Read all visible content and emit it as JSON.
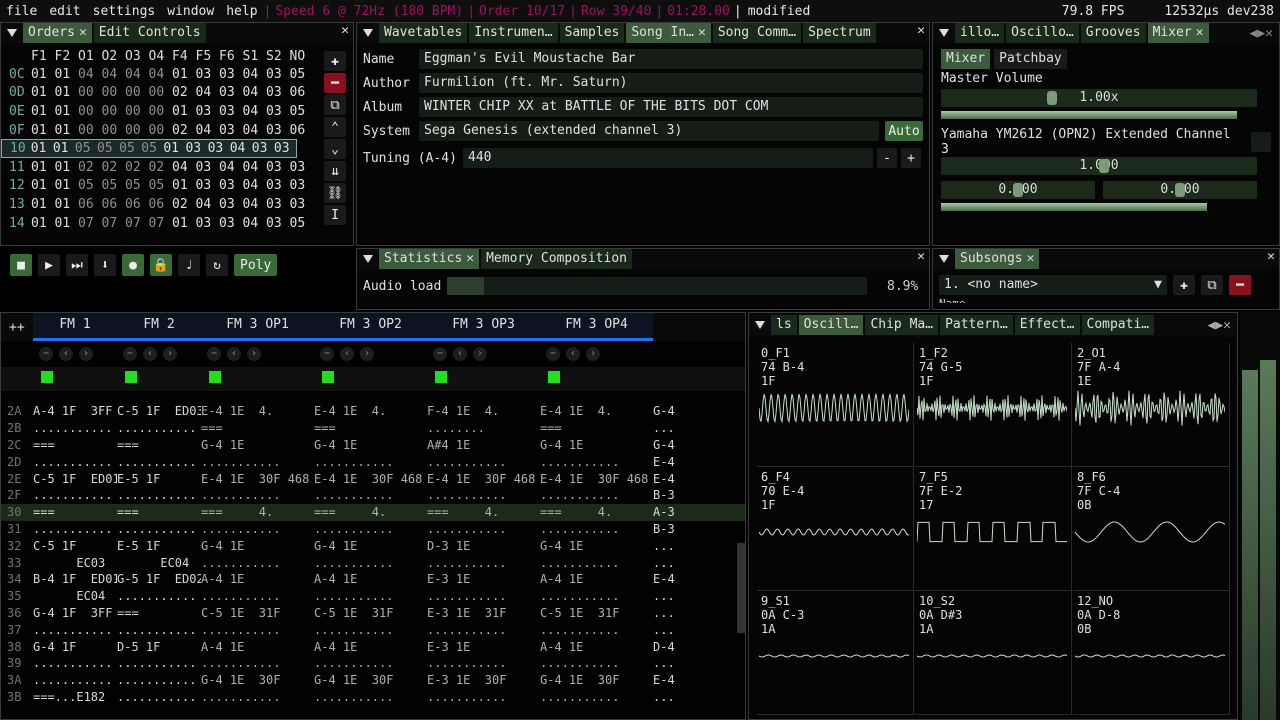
{
  "menu": {
    "items": [
      "file",
      "edit",
      "settings",
      "window",
      "help"
    ],
    "status": [
      "Speed 6 @ 72Hz (180 BPM)",
      "Order 10/17",
      "Row 39/40",
      "01:28.00"
    ],
    "modified": "modified",
    "fps": "79.8 FPS",
    "timing": "12532µs dev238"
  },
  "orders": {
    "tabs": [
      "Orders",
      "Edit Controls"
    ],
    "header": [
      "F1",
      "F2",
      "O1",
      "O2",
      "O3",
      "O4",
      "F4",
      "F5",
      "F6",
      "S1",
      "S2",
      "NO"
    ],
    "rows": [
      {
        "n": "0C",
        "v": [
          "01",
          "01",
          "04",
          "04",
          "04",
          "04",
          "01",
          "03",
          "03",
          "04",
          "03",
          "05"
        ]
      },
      {
        "n": "0D",
        "v": [
          "01",
          "01",
          "00",
          "00",
          "00",
          "00",
          "02",
          "04",
          "03",
          "04",
          "03",
          "06"
        ]
      },
      {
        "n": "0E",
        "v": [
          "01",
          "01",
          "00",
          "00",
          "00",
          "00",
          "01",
          "03",
          "03",
          "04",
          "03",
          "05"
        ]
      },
      {
        "n": "0F",
        "v": [
          "01",
          "01",
          "00",
          "00",
          "00",
          "00",
          "02",
          "04",
          "03",
          "04",
          "03",
          "06"
        ]
      },
      {
        "n": "10",
        "v": [
          "01",
          "01",
          "05",
          "05",
          "05",
          "05",
          "01",
          "03",
          "03",
          "04",
          "03",
          "03"
        ],
        "sel": true
      },
      {
        "n": "11",
        "v": [
          "01",
          "01",
          "02",
          "02",
          "02",
          "02",
          "04",
          "03",
          "04",
          "04",
          "03",
          "03"
        ]
      },
      {
        "n": "12",
        "v": [
          "01",
          "01",
          "05",
          "05",
          "05",
          "05",
          "01",
          "03",
          "03",
          "04",
          "03",
          "03"
        ]
      },
      {
        "n": "13",
        "v": [
          "01",
          "01",
          "06",
          "06",
          "06",
          "06",
          "02",
          "04",
          "03",
          "04",
          "03",
          "03"
        ]
      },
      {
        "n": "14",
        "v": [
          "01",
          "01",
          "07",
          "07",
          "07",
          "07",
          "01",
          "03",
          "03",
          "04",
          "03",
          "05"
        ]
      }
    ]
  },
  "songinfo": {
    "tabs": [
      "Wavetables",
      "Instrumen…",
      "Samples",
      "Song In…",
      "Song Comm…",
      "Spectrum"
    ],
    "name_label": "Name",
    "name": "Eggman's Evil Moustache Bar",
    "author_label": "Author",
    "author": "Furmilion (ft. Mr. Saturn)",
    "album_label": "Album",
    "album": "WINTER CHIP XX at BATTLE OF THE BITS DOT COM",
    "system_label": "System",
    "system": "Sega Genesis (extended channel 3)",
    "auto": "Auto",
    "tuning_label": "Tuning (A-4)",
    "tuning": "440",
    "minus": "-",
    "plus": "+"
  },
  "mixer": {
    "tabs": [
      "illo…",
      "Oscillo…",
      "Grooves",
      "Mixer"
    ],
    "subtabs": [
      "Mixer",
      "Patchbay"
    ],
    "master_label": "Master Volume",
    "master": "1.00x",
    "chip": "Yamaha YM2612 (OPN2) Extended Channel 3",
    "chip_vol": "1.000",
    "pan_l": "0.000",
    "pan_r": "0.000",
    "master_level": 0.66
  },
  "stats": {
    "tabs": [
      "Statistics",
      "Memory Composition"
    ],
    "audio_label": "Audio load",
    "audio": "8.9%",
    "load": 0.089
  },
  "subsongs": {
    "tab": "Subsongs",
    "item": "1. <no name>",
    "name_label": "Name"
  },
  "transport": {
    "poly": "Poly"
  },
  "pattern": {
    "channels": [
      "FM 1",
      "FM 2",
      "FM 3 OP1",
      "FM 3 OP2",
      "FM 3 OP3",
      "FM 3 OP4"
    ],
    "plus": "++",
    "rows": [
      {
        "n": "2A",
        "c": [
          "A-4 1F  3FF",
          "C-5 1F  ED03",
          "E-4 1E  4.",
          "E-4 1E  4.",
          "F-4 1E  4.",
          "E-4 1E  4.",
          "G-4"
        ]
      },
      {
        "n": "2B",
        "c": [
          "...........",
          "...........",
          "===        ",
          "===        ",
          "........",
          "===        ",
          "..."
        ]
      },
      {
        "n": "2C",
        "c": [
          "===        ",
          "===        ",
          "G-4 1E     ",
          "G-4 1E     ",
          "A#4 1E     ",
          "G-4 1E     ",
          "G-4"
        ]
      },
      {
        "n": "2D",
        "c": [
          "...........",
          "...........",
          "...........",
          "...........",
          "...........",
          "...........",
          "E-4"
        ]
      },
      {
        "n": "2E",
        "c": [
          "C-5 1F  ED01",
          "E-5 1F     ",
          "E-4 1E  30F 468",
          "E-4 1E  30F 468",
          "E-4 1E  30F 468",
          "E-4 1E  30F 468",
          "E-4"
        ]
      },
      {
        "n": "2F",
        "c": [
          "...........",
          "...........",
          "...........",
          "...........",
          "...........",
          "...........",
          "B-3"
        ]
      },
      {
        "n": "30",
        "c": [
          "===        ",
          "===        ",
          "===     4.",
          "===     4.",
          "===     4.",
          "===     4.",
          "A-3"
        ],
        "cur": true
      },
      {
        "n": "31",
        "c": [
          "...........",
          "...........",
          "...........",
          "...........",
          "...........",
          "...........",
          "B-3"
        ]
      },
      {
        "n": "32",
        "c": [
          "C-5 1F     ",
          "E-5 1F     ",
          "G-4 1E     ",
          "G-4 1E     ",
          "D-3 1E     ",
          "G-4 1E     ",
          "..."
        ]
      },
      {
        "n": "33",
        "c": [
          "      EC03 ",
          "      EC04 ",
          "...........",
          "...........",
          "...........",
          "...........",
          "..."
        ]
      },
      {
        "n": "34",
        "c": [
          "B-4 1F  ED01",
          "G-5 1F  ED02",
          "A-4 1E     ",
          "A-4 1E     ",
          "E-3 1E     ",
          "A-4 1E     ",
          "E-4"
        ]
      },
      {
        "n": "35",
        "c": [
          "      EC04 ",
          "...........",
          "...........",
          "...........",
          "...........",
          "...........",
          "..."
        ]
      },
      {
        "n": "36",
        "c": [
          "G-4 1F  3FF",
          "===        ",
          "C-5 1E  31F",
          "C-5 1E  31F",
          "E-3 1E  31F",
          "C-5 1E  31F",
          "..."
        ]
      },
      {
        "n": "37",
        "c": [
          "...........",
          "...........",
          "...........",
          "...........",
          "...........",
          "...........",
          "..."
        ]
      },
      {
        "n": "38",
        "c": [
          "G-4 1F     ",
          "D-5 1F     ",
          "A-4 1E     ",
          "A-4 1E     ",
          "E-3 1E     ",
          "A-4 1E     ",
          "D-4"
        ]
      },
      {
        "n": "39",
        "c": [
          "...........",
          "...........",
          "...........",
          "...........",
          "...........",
          "...........",
          "..."
        ]
      },
      {
        "n": "3A",
        "c": [
          "...........",
          "...........",
          "G-4 1E  30F",
          "G-4 1E  30F",
          "E-3 1E  30F",
          "G-4 1E  30F",
          "E-4"
        ]
      },
      {
        "n": "3B",
        "c": [
          "===...E182 ",
          "...........",
          "...........",
          "...........",
          "...........",
          "...........",
          "..."
        ]
      }
    ]
  },
  "oscillo": {
    "tabs": [
      "ls",
      "Oscill…",
      "Chip Ma…",
      "Pattern…",
      "Effect…",
      "Compati…"
    ],
    "cells": [
      {
        "id": "0_F1",
        "l2": "74 B-4",
        "l3": "1F"
      },
      {
        "id": "1_F2",
        "l2": "74 G-5",
        "l3": "1F"
      },
      {
        "id": "2_O1",
        "l2": "7F A-4",
        "l3": "1E"
      },
      {
        "id": "6_F4",
        "l2": "70 E-4",
        "l3": "1F"
      },
      {
        "id": "7_F5",
        "l2": "7F E-2",
        "l3": "17"
      },
      {
        "id": "8_F6",
        "l2": "7F C-4",
        "l3": "0B"
      },
      {
        "id": "9_S1",
        "l2": "0A C-3",
        "l3": "1A"
      },
      {
        "id": "10_S2",
        "l2": "0A D#3",
        "l3": "1A"
      },
      {
        "id": "12_NO",
        "l2": "0A D-8",
        "l3": "0B"
      }
    ]
  },
  "colors": {
    "accent": "#3c5a3c",
    "status": "#a01060",
    "channel_bar": "#1f6fff",
    "led": "#22dd22"
  }
}
